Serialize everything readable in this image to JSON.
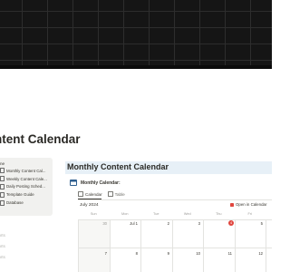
{
  "page": {
    "title": "ntent Calendar"
  },
  "toc": {
    "heading": "ne",
    "items": [
      "Monthly Content Cal...",
      "Weekly Content Cale...",
      "Daily Posting Sched...",
      "Template Guide",
      "Database"
    ]
  },
  "faded_items": [
    "ports",
    "ports",
    "ports"
  ],
  "main": {
    "heading": "Monthly Content Calendar",
    "database_title": "Monthly Calendar:"
  },
  "tabs": [
    {
      "label": "Calendar",
      "active": true
    },
    {
      "label": "Table",
      "active": false
    }
  ],
  "open_in_calendar_label": "Open in Calendar",
  "calendar": {
    "month_label": "July 2024",
    "weekdays": [
      "Sun",
      "Mon",
      "Tue",
      "Wed",
      "Thu",
      "Fri",
      "Sat"
    ],
    "week1": [
      "",
      "30",
      "Jul 1",
      "2",
      "3",
      "4",
      "5"
    ],
    "week2": [
      "",
      "7",
      "8",
      "9",
      "10",
      "11",
      "12"
    ],
    "today": "4",
    "accent": "#e0463e"
  }
}
